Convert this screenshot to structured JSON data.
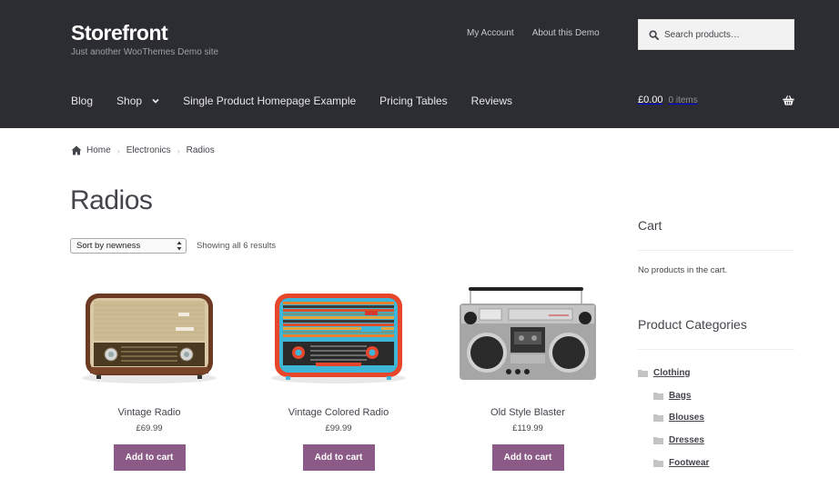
{
  "header": {
    "site_title": "Storefront",
    "site_description": "Just another WooThemes Demo site",
    "secondary_nav": [
      "My Account",
      "About this Demo"
    ],
    "search_placeholder": "Search products…",
    "primary_nav": [
      {
        "label": "Blog",
        "has_dropdown": false
      },
      {
        "label": "Shop",
        "has_dropdown": true
      },
      {
        "label": "Single Product Homepage Example",
        "has_dropdown": false
      },
      {
        "label": "Pricing Tables",
        "has_dropdown": false
      },
      {
        "label": "Reviews",
        "has_dropdown": false
      }
    ],
    "cart": {
      "amount": "£0.00",
      "count": "0 items",
      "icon": "basket-icon"
    }
  },
  "breadcrumb": {
    "items": [
      "Home",
      "Electronics",
      "Radios"
    ]
  },
  "main": {
    "page_title": "Radios",
    "sort_selected": "Sort by newness",
    "result_count": "Showing all 6 results",
    "products": [
      {
        "name": "Vintage Radio",
        "price": "£69.99",
        "button": "Add to cart"
      },
      {
        "name": "Vintage Colored Radio",
        "price": "£99.99",
        "button": "Add to cart"
      },
      {
        "name": "Old Style Blaster",
        "price": "£119.99",
        "button": "Add to cart"
      }
    ]
  },
  "sidebar": {
    "cart_title": "Cart",
    "cart_empty": "No products in the cart.",
    "categories_title": "Product Categories",
    "categories": [
      {
        "label": "Clothing",
        "child": false
      },
      {
        "label": "Bags",
        "child": true
      },
      {
        "label": "Blouses",
        "child": true
      },
      {
        "label": "Dresses",
        "child": true
      },
      {
        "label": "Footwear",
        "child": true
      }
    ]
  },
  "colors": {
    "header_bg": "#2c2d33",
    "button_bg": "#8b5a87",
    "search_bg": "#f2f2f2"
  }
}
